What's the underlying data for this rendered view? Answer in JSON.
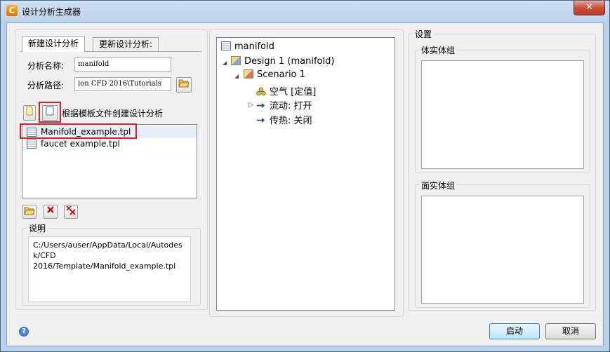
{
  "window": {
    "title": "设计分析生成器",
    "app_icon": "C",
    "close_icon": "✕"
  },
  "left": {
    "tabs": [
      {
        "label": "新建设计分析",
        "active": true
      },
      {
        "label": "更新设计分析:",
        "active": false
      }
    ],
    "analysis_name_label": "分析名称:",
    "analysis_name_value": "manifold",
    "analysis_path_label": "分析路径:",
    "analysis_path_value": "ion CFD 2016\\Tutorials",
    "create_from_template_label": "根据模板文件创建设计分析",
    "templates": [
      {
        "name": "Manifold_example.tpl",
        "selected": true
      },
      {
        "name": "faucet example.tpl",
        "selected": false
      }
    ],
    "description_title": "说明",
    "description_text": "C:/Users/auser/AppData/Local/Autodes k/CFD 2016/Template/Manifold_example.tpl"
  },
  "tree": {
    "root": "manifold",
    "design": "Design 1 (manifold)",
    "scenario": "Scenario 1",
    "items": [
      {
        "label": "空气 [定值]",
        "icon": "molecule-icon"
      },
      {
        "label": "流动: 打开",
        "icon": "arrow-right-icon"
      },
      {
        "label": "传热: 关闭",
        "icon": "arrow-right-icon"
      }
    ]
  },
  "settings": {
    "title": "设置",
    "body_group_title": "体实体组",
    "face_group_title": "面实体组"
  },
  "footer": {
    "help_icon": "?",
    "start_label": "启动",
    "cancel_label": "取消"
  },
  "colors": {
    "highlight_box": "#e02020",
    "title_bar": "#bcd3ec",
    "primary_button": "#bee6fd"
  }
}
